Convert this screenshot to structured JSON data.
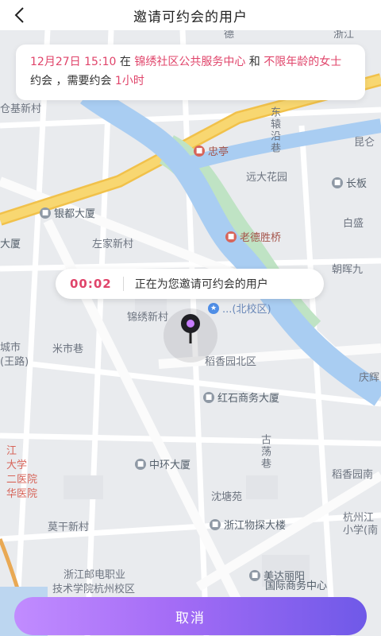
{
  "header": {
    "title": "邀请可约会的用户",
    "back_icon": "chevron-left-icon"
  },
  "invite": {
    "date_time": "12月27日 15:10",
    "at": " 在 ",
    "place": "锦绣社区公共服务中心",
    "and": " 和 ",
    "target": "不限年龄的女士",
    "date_word": " 约会 ，需要约会 ",
    "duration": "1小时"
  },
  "status": {
    "countdown": "00:02",
    "message": "正在为您邀请可约会的用户"
  },
  "map": {
    "labels": {
      "jixin": "仓基新村",
      "zuojia": "左家新村",
      "chengshi": "城市",
      "wangroad": "(王路)",
      "jinxiu": "锦绣新村",
      "mishixiang": "米市巷",
      "daoxiang": "稻香园北区",
      "baisheng": "白盛",
      "yuanda": "远大花园",
      "kunzhai": "昆仑",
      "chaohui": "朝晖九",
      "qingxiang": "庆辉",
      "mogan": "莫干新村",
      "shentang": "沈塘苑",
      "daoxiangnan": "稻香园南",
      "xiangxue1": "杭州江",
      "xiangxue2": "小学(南",
      "postal1": "浙江邮电职业",
      "postal2": "技术学院杭州校区",
      "hosp1": "江",
      "hosp2": "大学",
      "hosp3": "二医院",
      "hosp4": "华医院",
      "gudangxiang": "古荡巷",
      "dongxiang": "东辕沿巷",
      "de": "德",
      "zhe": "浙江"
    },
    "pois": {
      "zhongting": "忠亭",
      "yindu": "银都大厦",
      "laodeshengqiao": "老德胜桥",
      "changban": "长板",
      "hongshi": "红石商务大厦",
      "zhonghuan": "中环大厦",
      "wutan": "浙江物探大楼",
      "meida1": "美达丽阳",
      "meida2": "国际商务中心",
      "school1": "...(北校区)",
      "dasha": "大厦"
    }
  },
  "cancel_button": {
    "label": "取消"
  },
  "colors": {
    "accent": "#e0446a",
    "river": "#a9cdf2",
    "road_major": "#f6cf5f",
    "button_start": "#c18cff",
    "button_end": "#6f59e8"
  }
}
